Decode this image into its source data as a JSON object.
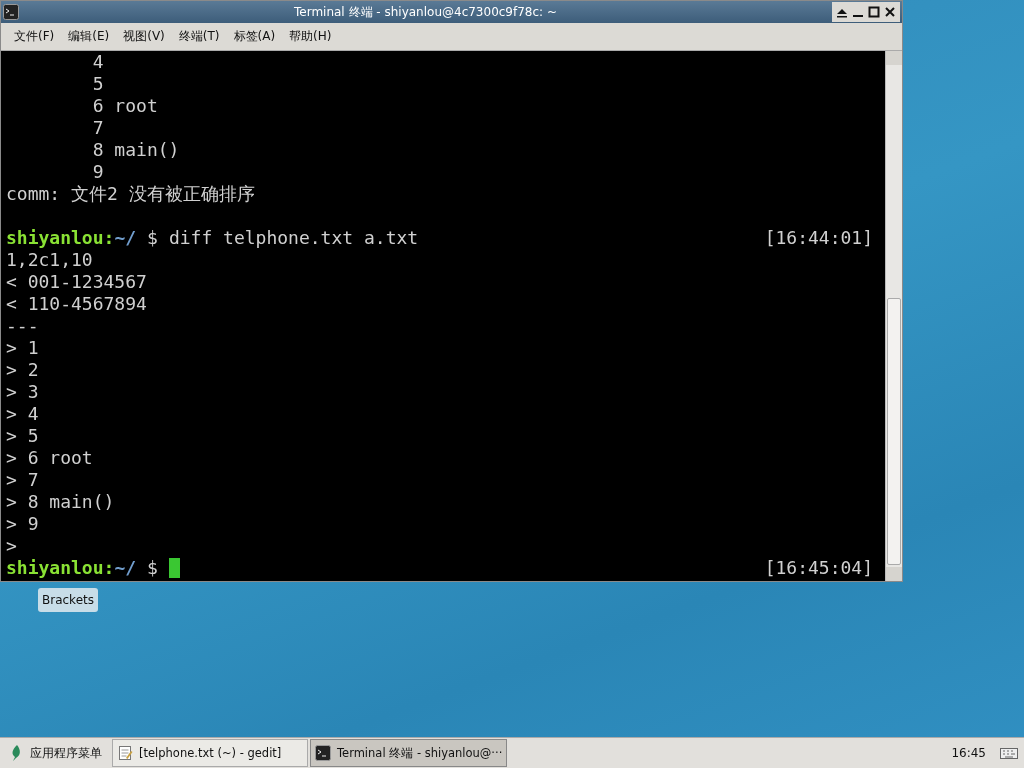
{
  "window": {
    "title": "Terminal 终端 - shiyanlou@4c7300c9f78c: ~"
  },
  "menu": [
    "文件(F)",
    "编辑(E)",
    "视图(V)",
    "终端(T)",
    "标签(A)",
    "帮助(H)"
  ],
  "terminal_lines": [
    {
      "kind": "output",
      "text": "        4"
    },
    {
      "kind": "output",
      "text": "        5"
    },
    {
      "kind": "output",
      "text": "        6 root"
    },
    {
      "kind": "output",
      "text": "        7"
    },
    {
      "kind": "output",
      "text": "        8 main()"
    },
    {
      "kind": "output",
      "text": "        9"
    },
    {
      "kind": "output",
      "text": "comm: 文件2 没有被正确排序"
    },
    {
      "kind": "blank"
    },
    {
      "kind": "prompt",
      "user": "shiyanlou:",
      "path": "~/",
      "symbol": "$",
      "command": "diff telphone.txt a.txt",
      "time": "[16:44:01]"
    },
    {
      "kind": "output",
      "text": "1,2c1,10"
    },
    {
      "kind": "output",
      "text": "< 001-1234567"
    },
    {
      "kind": "output",
      "text": "< 110-4567894"
    },
    {
      "kind": "output",
      "text": "---"
    },
    {
      "kind": "output",
      "text": "> 1"
    },
    {
      "kind": "output",
      "text": "> 2"
    },
    {
      "kind": "output",
      "text": "> 3"
    },
    {
      "kind": "output",
      "text": "> 4"
    },
    {
      "kind": "output",
      "text": "> 5"
    },
    {
      "kind": "output",
      "text": "> 6 root"
    },
    {
      "kind": "output",
      "text": "> 7"
    },
    {
      "kind": "output",
      "text": "> 8 main()"
    },
    {
      "kind": "output",
      "text": "> 9"
    },
    {
      "kind": "output",
      "text": ">"
    },
    {
      "kind": "prompt",
      "user": "shiyanlou:",
      "path": "~/",
      "symbol": "$",
      "time": "[16:45:04]",
      "cursor": true
    }
  ],
  "desktop_label": "Brackets",
  "taskbar": {
    "menu_label": "应用程序菜单",
    "tasks": [
      {
        "label": "[telphone.txt (~) - gedit]",
        "kind": "editor",
        "selected": false
      },
      {
        "label": "Terminal 终端 - shiyanlou@···",
        "kind": "terminal",
        "selected": true
      }
    ],
    "clock": "16:45"
  }
}
